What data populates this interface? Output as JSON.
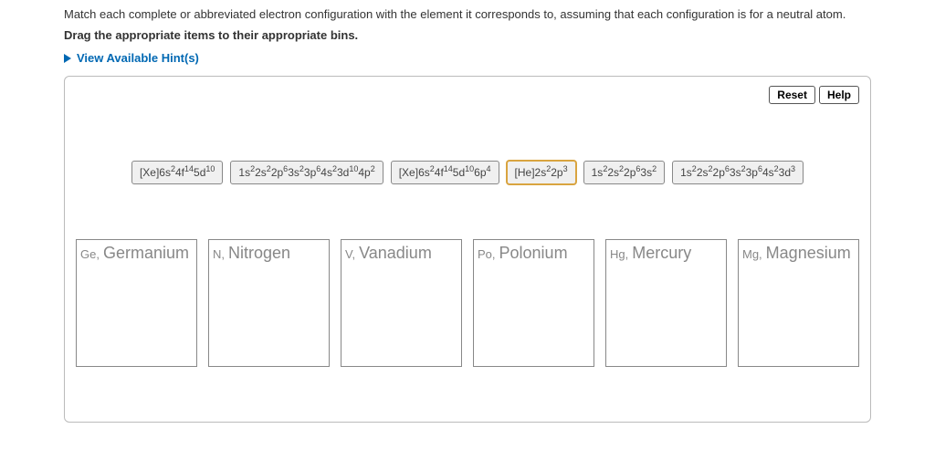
{
  "instruction": "Match each complete or abbreviated electron configuration with the element it corresponds to, assuming that each configuration is for a neutral atom.",
  "bold_instruction": "Drag the appropriate items to their appropriate bins.",
  "hints_label": "View Available Hint(s)",
  "toolbar": {
    "reset": "Reset",
    "help": "Help"
  },
  "tiles": [
    {
      "html": "[Xe]6s<sup>2</sup>4f<sup>14</sup>5d<sup>10</sup>"
    },
    {
      "html": "1s<sup>2</sup>2s<sup>2</sup>2p<sup>6</sup>3s<sup>2</sup>3p<sup>6</sup>4s<sup>2</sup>3d<sup>10</sup>4p<sup>2</sup>"
    },
    {
      "html": "[Xe]6s<sup>2</sup>4f<sup>14</sup>5d<sup>10</sup>6p<sup>4</sup>"
    },
    {
      "html": "[He]2s<sup>2</sup>2p<sup>3</sup>",
      "selected": true
    },
    {
      "html": "1s<sup>2</sup>2s<sup>2</sup>2p<sup>6</sup>3s<sup>2</sup>"
    },
    {
      "html": "1s<sup>2</sup>2s<sup>2</sup>2p<sup>6</sup>3s<sup>2</sup>3p<sup>6</sup>4s<sup>2</sup>3d<sup>3</sup>"
    }
  ],
  "bins": [
    {
      "symbol": "Ge,",
      "name": "Germanium"
    },
    {
      "symbol": "N,",
      "name": "Nitrogen"
    },
    {
      "symbol": "V,",
      "name": "Vanadium"
    },
    {
      "symbol": "Po,",
      "name": "Polonium"
    },
    {
      "symbol": "Hg,",
      "name": "Mercury"
    },
    {
      "symbol": "Mg,",
      "name": "Magnesium"
    }
  ]
}
